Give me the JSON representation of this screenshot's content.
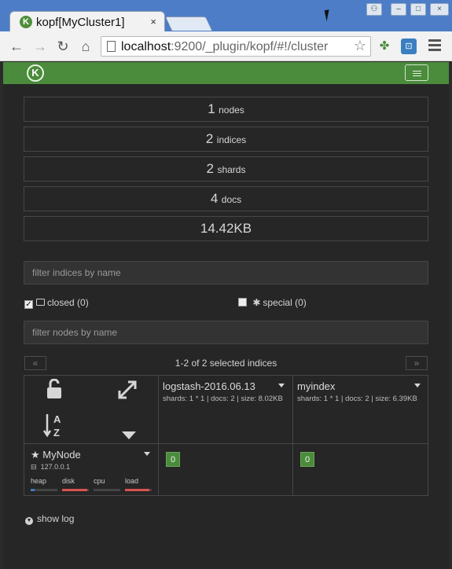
{
  "browser": {
    "tab_title": "kopf[MyCluster1]",
    "tab_close": "×",
    "url_host": "localhost",
    "url_rest": ":9200/_plugin/kopf/#!/cluster"
  },
  "navbar": {
    "brand_letter": "K"
  },
  "stats": [
    {
      "value": "1",
      "label": "nodes"
    },
    {
      "value": "2",
      "label": "indices"
    },
    {
      "value": "2",
      "label": "shards"
    },
    {
      "value": "4",
      "label": "docs"
    },
    {
      "value": "14.42KB",
      "label": ""
    }
  ],
  "filters": {
    "indices_placeholder": "filter indices by name",
    "nodes_placeholder": "filter nodes by name",
    "closed_label": "closed (0)",
    "special_label": "special (0)"
  },
  "pagination": {
    "prev": "«",
    "next": "»",
    "info": "1-2 of 2 selected indices"
  },
  "indices": [
    {
      "name": "logstash-2016.06.13",
      "meta": "shards: 1 * 1 | docs: 2 | size: 8.02KB",
      "shard": "0"
    },
    {
      "name": "myindex",
      "meta": "shards: 1 * 1 | docs: 2 | size: 6.39KB",
      "shard": "0"
    }
  ],
  "node": {
    "name": "MyNode",
    "ip": "127.0.0.1",
    "gauges": [
      {
        "label": "heap",
        "level": 0.15,
        "color": "#3a7fc1"
      },
      {
        "label": "disk",
        "level": 0.95,
        "color": "#d9534f"
      },
      {
        "label": "cpu",
        "level": 0.0,
        "color": "#d9534f"
      },
      {
        "label": "load",
        "level": 0.9,
        "color": "#d9534f"
      }
    ]
  },
  "footer": {
    "show_log": "show log"
  },
  "colors": {
    "brand_green": "#4a8b3c",
    "background": "#262626"
  }
}
